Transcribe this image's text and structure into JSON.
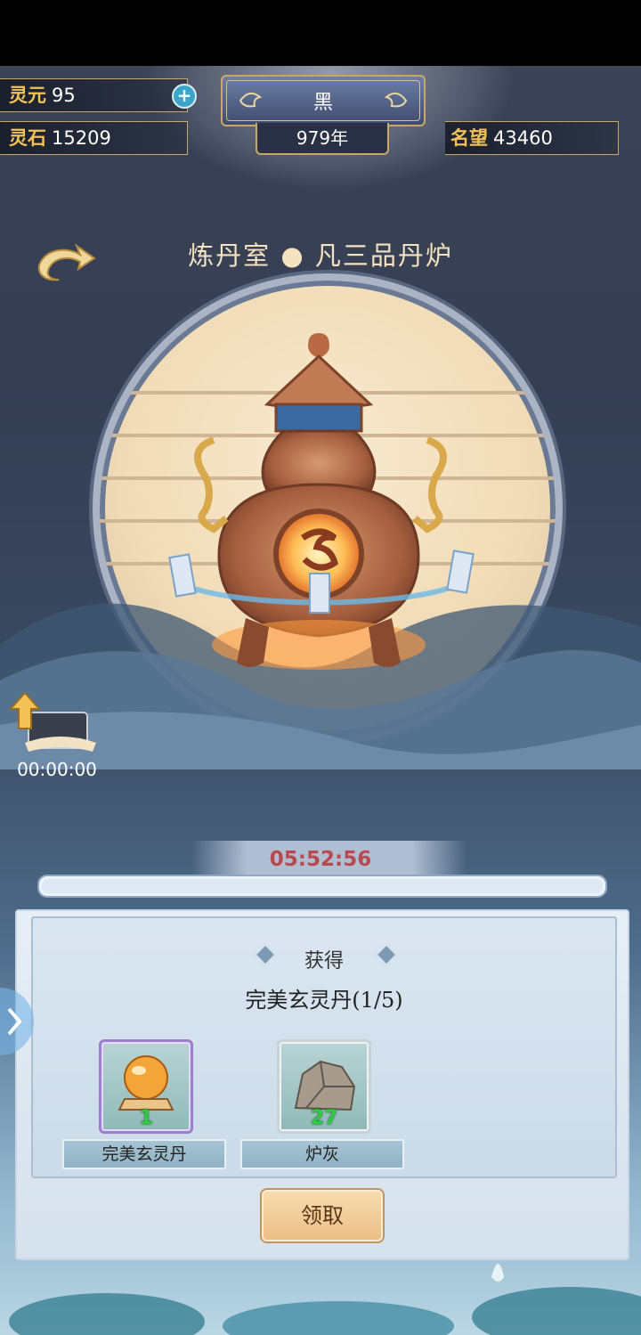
{
  "header": {
    "lingyuan": {
      "label": "灵元",
      "value": "95",
      "plus": "+"
    },
    "lingshi": {
      "label": "灵石",
      "value": "15209"
    },
    "mingwang": {
      "label": "名望",
      "value": "43460"
    },
    "time_of_day": "黑",
    "year": "979年"
  },
  "room": {
    "title": "炼丹室 ● 凡三品丹炉"
  },
  "upgrade": {
    "timer": "00:00:00"
  },
  "refine": {
    "countdown": "05:52:56",
    "progress": 0.0
  },
  "reward_panel": {
    "heading": "获得",
    "product": "完美玄灵丹(1/5)",
    "items": [
      {
        "name": "完美玄灵丹",
        "qty": "1",
        "rarity": "purple",
        "icon": "golden-orb-icon"
      },
      {
        "name": "炉灰",
        "qty": "27",
        "rarity": "grey",
        "icon": "rock-ash-icon"
      }
    ],
    "claim_label": "领取"
  },
  "colors": {
    "gold": "#f2c257",
    "countdown": "#b8494f",
    "qty": "#2ecc40"
  }
}
